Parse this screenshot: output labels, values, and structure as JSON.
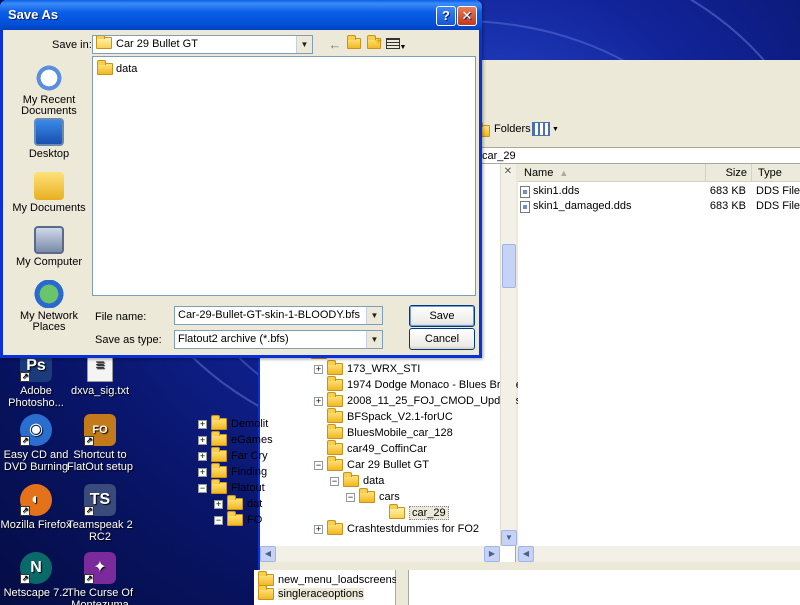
{
  "dialog": {
    "title": "Save As",
    "save_in_label": "Save in:",
    "save_in_value": "Car 29 Bullet GT",
    "places": [
      {
        "label": "My Recent Documents",
        "icon": "recent-documents-icon"
      },
      {
        "label": "Desktop",
        "icon": "desktop-icon"
      },
      {
        "label": "My Documents",
        "icon": "my-documents-icon"
      },
      {
        "label": "My Computer",
        "icon": "my-computer-icon"
      },
      {
        "label": "My Network Places",
        "icon": "network-places-icon"
      }
    ],
    "files": [
      {
        "name": "data",
        "icon": "folder-icon"
      }
    ],
    "file_name_label": "File name:",
    "file_name_value": "Car-29-Bullet-GT-skin-1-BLOODY.bfs",
    "save_type_label": "Save as type:",
    "save_type_value": "Flatout2 archive (*.bfs)",
    "save_button": "Save",
    "cancel_button": "Cancel",
    "help_glyph": "?",
    "close_glyph": "✕"
  },
  "explorer": {
    "folders_button": "Folders",
    "address_fragment": "car_29",
    "columns": {
      "name": "Name",
      "size": "Size",
      "type": "Type"
    },
    "files": [
      {
        "name": "skin1.dds",
        "size": "683 KB",
        "type": "DDS File"
      },
      {
        "name": "skin1_damaged.dds",
        "size": "683 KB",
        "type": "DDS File"
      }
    ],
    "tree_left": [
      {
        "label": "Demolit"
      },
      {
        "label": "eGames"
      },
      {
        "label": "Far Cry"
      },
      {
        "label": "Finding"
      },
      {
        "label": "Flatout"
      },
      {
        "label": "dat"
      },
      {
        "label": "FO"
      }
    ],
    "tree": [
      {
        "label": "Flatout"
      },
      {
        "label": "Flatout5"
      },
      {
        "label": "flatout 2"
      },
      {
        "label": "173_WRX_STI"
      },
      {
        "label": "1974 Dodge Monaco - Blues Brothers I"
      },
      {
        "label": "2008_11_25_FOJ_CMOD_Updates2_p"
      },
      {
        "label": "BFSpack_V2.1-forUC"
      },
      {
        "label": "BluesMobile_car_128"
      },
      {
        "label": "car49_CoffinCar"
      },
      {
        "label": "Car 29 Bullet GT"
      },
      {
        "label": "data"
      },
      {
        "label": "cars"
      },
      {
        "label": "car_29"
      },
      {
        "label": "Crashtestdummies for FO2"
      }
    ],
    "tree2": [
      {
        "label": "new_menu_loadscreens"
      },
      {
        "label": "singleraceoptions"
      }
    ]
  },
  "desktop_icons": [
    {
      "label": "Adobe Photosho...",
      "color": "#1a3a7a",
      "glyph": "Ps"
    },
    {
      "label": "dxva_sig.txt",
      "color": "#f4f4f4",
      "glyph": "≡"
    },
    {
      "label": "Easy CD and DVD Burning",
      "color": "#2a6fd0",
      "glyph": "◉"
    },
    {
      "label": "Shortcut to FlatOut setup",
      "color": "#c27a1a",
      "glyph": "FO"
    },
    {
      "label": "Mozilla Firefox",
      "color": "#e4721a",
      "glyph": "◐"
    },
    {
      "label": "Teamspeak 2 RC2",
      "color": "#3a4a7a",
      "glyph": "TS"
    },
    {
      "label": "Netscape 7.2",
      "color": "#0a6a6a",
      "glyph": "N"
    },
    {
      "label": "The Curse Of Montezuma",
      "color": "#7a2a9a",
      "glyph": "✦"
    }
  ],
  "colors": {
    "titlebar": "#0a5ee8",
    "window_bg": "#ece9d8",
    "folder": "#f1b924"
  }
}
